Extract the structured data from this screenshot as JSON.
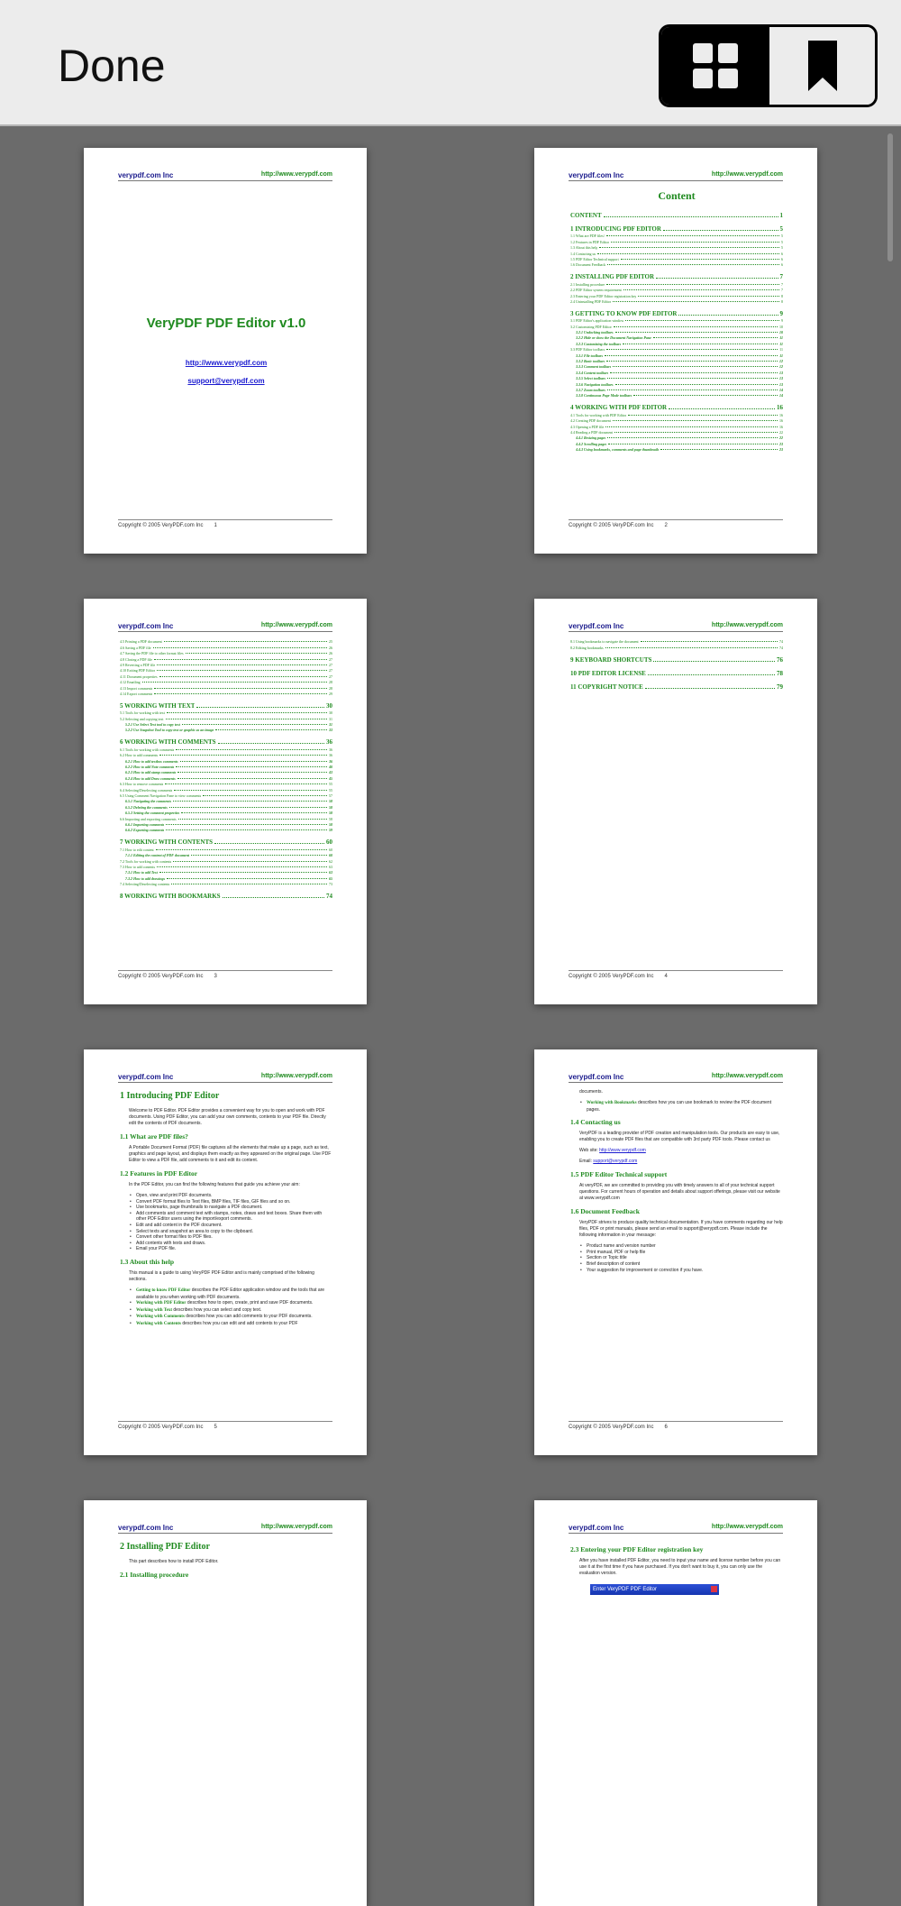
{
  "toolbar": {
    "done_label": "Done",
    "view_grid_icon": "grid-icon",
    "bookmark_icon": "bookmark-icon"
  },
  "doc": {
    "logo": "verypdf.com Inc",
    "url": "http://www.verypdf.com",
    "copyright": "Copyright © 2005 VeryPDF.com Inc",
    "cover_title": "VeryPDF PDF Editor v1.0",
    "cover_url": "http://www.verypdf.com",
    "cover_email": "support@verypdf.com",
    "toc_heading": "Content"
  },
  "pages": [
    {
      "number": "1"
    },
    {
      "number": "2"
    },
    {
      "number": "3"
    },
    {
      "number": "4"
    },
    {
      "number": "5"
    },
    {
      "number": "6"
    },
    {
      "number": ""
    },
    {
      "number": ""
    }
  ],
  "toc_p2": [
    {
      "lvl": 1,
      "t": "CONTENT",
      "n": "1"
    },
    {
      "lvl": 1,
      "t": "1 INTRODUCING PDF EDITOR",
      "n": "5"
    },
    {
      "lvl": 2,
      "t": "1.1 What are PDF files?",
      "n": "5"
    },
    {
      "lvl": 2,
      "t": "1.2 Features in PDF Editor",
      "n": "5"
    },
    {
      "lvl": 2,
      "t": "1.3 About this help",
      "n": "5"
    },
    {
      "lvl": 2,
      "t": "1.4 Contacting us",
      "n": "6"
    },
    {
      "lvl": 2,
      "t": "1.5 PDF Editor Technical support",
      "n": "6"
    },
    {
      "lvl": 2,
      "t": "1.6 Document Feedback",
      "n": "6"
    },
    {
      "lvl": 1,
      "t": "2 INSTALLING PDF EDITOR",
      "n": "7"
    },
    {
      "lvl": 2,
      "t": "2.1 Installing procedure",
      "n": "7"
    },
    {
      "lvl": 2,
      "t": "2.2 PDF Editor system requirement",
      "n": "7"
    },
    {
      "lvl": 2,
      "t": "2.3 Entering your PDF Editor registration key",
      "n": "8"
    },
    {
      "lvl": 2,
      "t": "2.4 Uninstalling PDF Editor",
      "n": "8"
    },
    {
      "lvl": 1,
      "t": "3 GETTING TO KNOW PDF EDITOR",
      "n": "9"
    },
    {
      "lvl": 2,
      "t": "3.1 PDF Editor's application window",
      "n": "9"
    },
    {
      "lvl": 2,
      "t": "3.2 Customizing PDF Editor",
      "n": "10"
    },
    {
      "lvl": 3,
      "t": "3.2.1 Undocking toolbars",
      "n": "10"
    },
    {
      "lvl": 3,
      "t": "3.2.2 Hide or show the Document Navigation Pane",
      "n": "11"
    },
    {
      "lvl": 3,
      "t": "3.2.3 Customizing the toolbars",
      "n": "11"
    },
    {
      "lvl": 2,
      "t": "3.3 PDF Editor toolbars",
      "n": "11"
    },
    {
      "lvl": 3,
      "t": "3.3.1 File toolbars",
      "n": "11"
    },
    {
      "lvl": 3,
      "t": "3.3.2 Basic toolbars",
      "n": "12"
    },
    {
      "lvl": 3,
      "t": "3.3.3 Comment toolbars",
      "n": "12"
    },
    {
      "lvl": 3,
      "t": "3.3.4 Content toolbars",
      "n": "13"
    },
    {
      "lvl": 3,
      "t": "3.3.5 Select toolbars",
      "n": "13"
    },
    {
      "lvl": 3,
      "t": "3.3.6 Navigation toolbars",
      "n": "13"
    },
    {
      "lvl": 3,
      "t": "3.3.7 Zoom toolbars",
      "n": "14"
    },
    {
      "lvl": 3,
      "t": "3.3.8 Continuous Page Mode toolbars",
      "n": "14"
    },
    {
      "lvl": 1,
      "t": "4 WORKING WITH PDF EDITOR",
      "n": "16"
    },
    {
      "lvl": 2,
      "t": "4.1 Tools for working with PDF Editor",
      "n": "16"
    },
    {
      "lvl": 2,
      "t": "4.2 Creating PDF document",
      "n": "16"
    },
    {
      "lvl": 2,
      "t": "4.3 Opening a PDF file",
      "n": "16"
    },
    {
      "lvl": 2,
      "t": "4.4 Reading a PDF document",
      "n": "22"
    },
    {
      "lvl": 3,
      "t": "4.4.1 Resizing pages",
      "n": "22"
    },
    {
      "lvl": 3,
      "t": "4.4.2 Scrolling pages",
      "n": "23"
    },
    {
      "lvl": 3,
      "t": "4.4.3 Using bookmarks, comments and page thumbnails",
      "n": "23"
    }
  ],
  "toc_p3": [
    {
      "lvl": 2,
      "t": "4.5 Printing a PDF document",
      "n": "25"
    },
    {
      "lvl": 2,
      "t": "4.6 Saving a PDF file",
      "n": "26"
    },
    {
      "lvl": 2,
      "t": "4.7 Saving the PDF file to other format files",
      "n": "26"
    },
    {
      "lvl": 2,
      "t": "4.8 Closing a PDF file",
      "n": "27"
    },
    {
      "lvl": 2,
      "t": "4.9 Reverting a PDF file",
      "n": "27"
    },
    {
      "lvl": 2,
      "t": "4.10 Exiting PDF Editor",
      "n": "27"
    },
    {
      "lvl": 2,
      "t": "4.11 Document properties",
      "n": "27"
    },
    {
      "lvl": 2,
      "t": "4.12 Emailing",
      "n": "28"
    },
    {
      "lvl": 2,
      "t": "4.13 Import comments",
      "n": "28"
    },
    {
      "lvl": 2,
      "t": "4.14 Export comments",
      "n": "29"
    },
    {
      "lvl": 1,
      "t": "5 WORKING WITH TEXT",
      "n": "30"
    },
    {
      "lvl": 2,
      "t": "5.1 Tools for working with text",
      "n": "30"
    },
    {
      "lvl": 2,
      "t": "5.2 Selecting and copying text",
      "n": "31"
    },
    {
      "lvl": 3,
      "t": "5.2.1 Use Select Text tool to copy text",
      "n": "31"
    },
    {
      "lvl": 3,
      "t": "5.2.2 Use Snapshot Tool to copy text or graphic as an image",
      "n": "33"
    },
    {
      "lvl": 1,
      "t": "6 WORKING WITH COMMENTS",
      "n": "36"
    },
    {
      "lvl": 2,
      "t": "6.1 Tools for working with comments",
      "n": "36"
    },
    {
      "lvl": 2,
      "t": "6.2 How to add comments",
      "n": "36"
    },
    {
      "lvl": 3,
      "t": "6.2.1 How to add textbox comments",
      "n": "36"
    },
    {
      "lvl": 3,
      "t": "6.2.2 How to add Note comments",
      "n": "40"
    },
    {
      "lvl": 3,
      "t": "6.2.3 How to add stamp comments",
      "n": "43"
    },
    {
      "lvl": 3,
      "t": "6.2.4 How to add Draw comments",
      "n": "45"
    },
    {
      "lvl": 2,
      "t": "6.3 How to remove comments",
      "n": "55"
    },
    {
      "lvl": 2,
      "t": "6.4 Selecting/Deselecting comments",
      "n": "55"
    },
    {
      "lvl": 2,
      "t": "6.5 Using Comment Navigation Pane to view comments",
      "n": "57"
    },
    {
      "lvl": 3,
      "t": "6.5.1 Navigating the comments",
      "n": "58"
    },
    {
      "lvl": 3,
      "t": "6.5.2 Deleting the comments",
      "n": "58"
    },
    {
      "lvl": 3,
      "t": "6.5.3 Setting the comment properties",
      "n": "58"
    },
    {
      "lvl": 2,
      "t": "6.6 Importing and exporting comments",
      "n": "58"
    },
    {
      "lvl": 3,
      "t": "6.6.1 Importing comments",
      "n": "58"
    },
    {
      "lvl": 3,
      "t": "6.6.2 Exporting comments",
      "n": "59"
    },
    {
      "lvl": 1,
      "t": "7 WORKING WITH CONTENTS",
      "n": "60"
    },
    {
      "lvl": 2,
      "t": "7.1 How to edit content",
      "n": "60"
    },
    {
      "lvl": 3,
      "t": "7.1.1 Editing the content of PDF document",
      "n": "60"
    },
    {
      "lvl": 2,
      "t": "7.2 Tools for working with contents",
      "n": "62"
    },
    {
      "lvl": 2,
      "t": "7.3 How to add contents",
      "n": "63"
    },
    {
      "lvl": 3,
      "t": "7.3.1 How to add Text",
      "n": "63"
    },
    {
      "lvl": 3,
      "t": "7.3.2 How to add drawings",
      "n": "65"
    },
    {
      "lvl": 2,
      "t": "7.4 Selecting/Deselecting contents",
      "n": "73"
    },
    {
      "lvl": 1,
      "t": "8 WORKING WITH BOOKMARKS",
      "n": "74"
    }
  ],
  "toc_p4": [
    {
      "lvl": 2,
      "t": "8.1 Using bookmarks to navigate the document",
      "n": "74"
    },
    {
      "lvl": 2,
      "t": "8.2 Editing bookmarks",
      "n": "74"
    },
    {
      "lvl": 1,
      "t": "9 KEYBOARD SHORTCUTS",
      "n": "76"
    },
    {
      "lvl": 1,
      "t": "10 PDF EDITOR LICENSE",
      "n": "78"
    },
    {
      "lvl": 1,
      "t": "11 COPYRIGHT NOTICE",
      "n": "79"
    }
  ],
  "p5": {
    "h1": "1 Introducing PDF Editor",
    "intro": "Welcome to PDF Editor. PDF Editor provides a convenient way for you to open and work with PDF documents. Using PDF Editor, you can add your own comments, contents to your PDF file. Directly edit the contents of PDF documents.",
    "h11": "1.1 What are PDF files?",
    "p11": "A Portable Document Format (PDF) file captures all the elements that make up a page, such as text, graphics and page layout, and displays them exactly as they appeared on the original page. Use PDF Editor to view a PDF file, add comments to it and edit its content.",
    "h12": "1.2 Features in PDF Editor",
    "p12": "In the PDF Editor, you can find the following features that guide you achieve your aim:",
    "features": [
      "Open, view and print PDF documents.",
      "Convert PDF format files to Text files, BMP files, TIF files, GIF files and so on.",
      "Use bookmarks, page thumbnails to navigate a PDF document.",
      "Add comments and comment text with stamps, notes, draws and text boxes. Share them with other PDF Editor users using the import/export comments.",
      "Edit and add content in the PDF document.",
      "Select texts and snapshot an area to copy to the clipboard.",
      "Convert other format files to PDF files.",
      "Add contents with texts and draws.",
      "Email your PDF file."
    ],
    "h13": "1.3 About this help",
    "p13": "This manual is a guide to using VeryPDF PDF Editor and is mainly comprised of the following sections.",
    "sections": [
      {
        "g": "Getting to know PDF Editor",
        "r": " describes the PDF Editor application window and the tools that are available to you when working with PDF documents."
      },
      {
        "g": "Working with PDF Editor",
        "r": " describes how to open, create, print and save PDF documents."
      },
      {
        "g": "Working with Text",
        "r": " describes how you can select and copy text."
      },
      {
        "g": "Working with Comments",
        "r": " describes how you can add comments to your PDF documents."
      },
      {
        "g": "Working with Contents",
        "r": " describes how you can edit and add contents to your PDF"
      }
    ]
  },
  "p6": {
    "cont": "documents.",
    "bm_g": "Working with Bookmarks",
    "bm_r": " describes how you can use bookmark to review the PDF document pages.",
    "h14": "1.4 Contacting us",
    "p14": "VeryPDF is a leading provider of PDF creation and manipulation tools. Our products are easy to use, enabling you to create PDF files that are compatible with 3rd party PDF tools. Please contact us",
    "web_label": "Web site: ",
    "web": "http://www.verypdf.com",
    "email_label": "Email: ",
    "email": "support@verypdf.com",
    "h15": "1.5 PDF Editor Technical support",
    "p15": "At veryPDF, we are committed to providing you with timely answers to all of your technical support questions. For current hours of operation and details about support offerings, please visit our website at www.verypdf.com",
    "h16": "1.6 Document Feedback",
    "p16": "VeryPDF strives to produce quality technical documentation. If you have comments regarding our help files, PDF or print manuals, please send an email to support@verypdf.com. Please include the following information in your message:",
    "feedback": [
      "Product name and version number",
      "Print manual, PDF or help file",
      "Section or Topic title",
      "Brief description of content",
      "Your suggestion for improvement or correction if you have."
    ]
  },
  "p7": {
    "h1": "2 Installing PDF Editor",
    "intro": "This part describes how to install PDF Editor.",
    "h21": "2.1 Installing procedure"
  },
  "p8": {
    "h23": "2.3 Entering your PDF Editor registration key",
    "p23": "After you have installed PDF Editor, you need to input your name and license number before you can use it at the first time if you have purchased. If you don't want to buy it, you can only use the evaluation version.",
    "win_title": "Enter VeryPDF PDF Editor"
  }
}
